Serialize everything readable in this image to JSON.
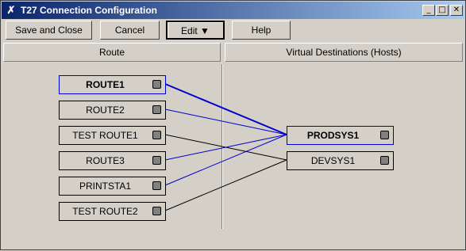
{
  "window": {
    "title": "T27 Connection Configuration"
  },
  "toolbar": {
    "save_close": "Save and Close",
    "cancel": "Cancel",
    "edit": "Edit ▼",
    "help": "Help"
  },
  "columns": {
    "route": "Route",
    "hosts": "Virtual Destinations (Hosts)"
  },
  "routes": [
    "ROUTE1",
    "ROUTE2",
    "TEST ROUTE1",
    "ROUTE3",
    "PRINTSTA1",
    "TEST ROUTE2"
  ],
  "hosts": [
    "PRODSYS1",
    "DEVSYS1"
  ],
  "colors": {
    "selected_link": "#0000cc",
    "link": "#000000"
  }
}
